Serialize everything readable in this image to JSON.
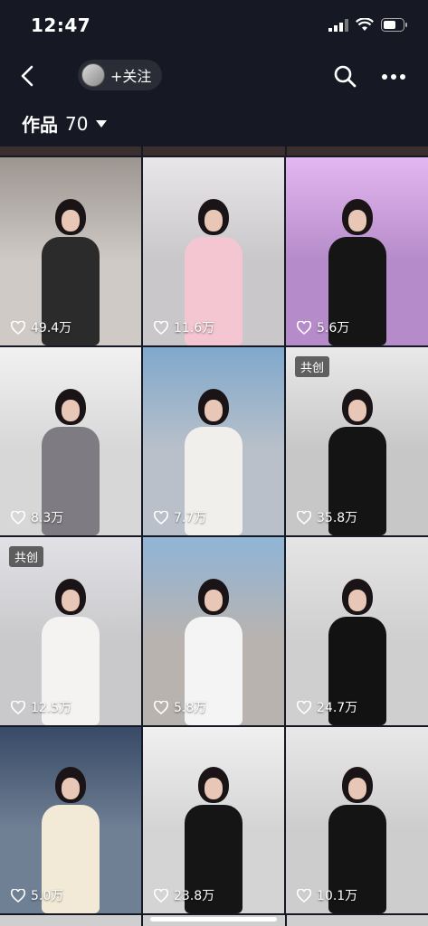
{
  "status_bar": {
    "time": "12:47"
  },
  "nav": {
    "follow_label": "+关注"
  },
  "works": {
    "label": "作品",
    "count": "70"
  },
  "tiles": [
    {
      "likes": "49.4万",
      "badge": "",
      "bg": "#cfcac6",
      "top": "#9c9590",
      "outfit": "#2b2b2b"
    },
    {
      "likes": "11.6万",
      "badge": "",
      "bg": "#c9c7c9",
      "top": "#e8e6e8",
      "outfit": "#f3c6d2"
    },
    {
      "likes": "5.6万",
      "badge": "",
      "bg": "#b58bc9",
      "top": "#e3b7f0",
      "outfit": "#151515"
    },
    {
      "likes": "8.3万",
      "badge": "",
      "bg": "#d7d7d7",
      "top": "#f1f1f1",
      "outfit": "#7f7b82"
    },
    {
      "likes": "7.7万",
      "badge": "",
      "bg": "#b9c0c9",
      "top": "#7fa8cc",
      "outfit": "#f0efec"
    },
    {
      "likes": "35.8万",
      "badge": "共创",
      "bg": "#c7c7c7",
      "top": "#e9e9e9",
      "outfit": "#141414"
    },
    {
      "likes": "12.5万",
      "badge": "共创",
      "bg": "#c9c9cc",
      "top": "#e2e2e6",
      "outfit": "#f5f2f2"
    },
    {
      "likes": "5.8万",
      "badge": "",
      "bg": "#b9b3b0",
      "top": "#8fb5d6",
      "outfit": "#f4f4f4"
    },
    {
      "likes": "24.7万",
      "badge": "",
      "bg": "#cfcfcf",
      "top": "#e5e5e5",
      "outfit": "#121212"
    },
    {
      "likes": "5.0万",
      "badge": "",
      "bg": "#6f7f94",
      "top": "#384a66",
      "outfit": "#f2ead6"
    },
    {
      "likes": "23.8万",
      "badge": "",
      "bg": "#d4d4d4",
      "top": "#f0f0f0",
      "outfit": "#151515"
    },
    {
      "likes": "10.1万",
      "badge": "",
      "bg": "#cdcdcd",
      "top": "#e8e8e8",
      "outfit": "#141414"
    }
  ]
}
